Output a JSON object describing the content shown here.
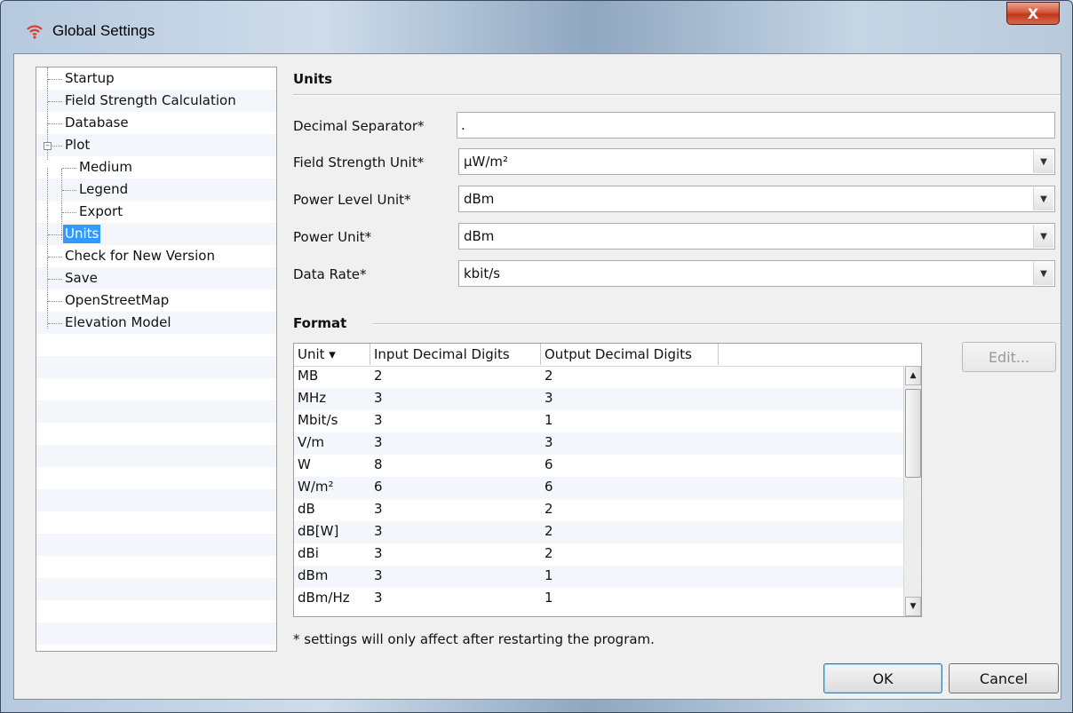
{
  "window": {
    "title": "Global Settings",
    "close_label": "X"
  },
  "tree": {
    "items": [
      {
        "label": "Startup",
        "level": 0
      },
      {
        "label": "Field Strength Calculation",
        "level": 0
      },
      {
        "label": "Database",
        "level": 0
      },
      {
        "label": "Plot",
        "level": 0,
        "expanded": true
      },
      {
        "label": "Medium",
        "level": 1
      },
      {
        "label": "Legend",
        "level": 1
      },
      {
        "label": "Export",
        "level": 1
      },
      {
        "label": "Units",
        "level": 0,
        "selected": true
      },
      {
        "label": "Check for New Version",
        "level": 0
      },
      {
        "label": "Save",
        "level": 0
      },
      {
        "label": "OpenStreetMap",
        "level": 0
      },
      {
        "label": "Elevation Model",
        "level": 0
      }
    ]
  },
  "units": {
    "heading": "Units",
    "decimal_separator": {
      "label": "Decimal Separator*",
      "value": "."
    },
    "field_strength_unit": {
      "label": "Field Strength Unit*",
      "value": "µW/m²"
    },
    "power_level_unit": {
      "label": "Power Level Unit*",
      "value": "dBm"
    },
    "power_unit": {
      "label": "Power Unit*",
      "value": "dBm"
    },
    "data_rate": {
      "label": "Data Rate*",
      "value": "kbit/s"
    }
  },
  "format": {
    "heading": "Format",
    "columns": [
      "Unit ▾",
      "Input Decimal Digits",
      "Output Decimal Digits"
    ],
    "rows": [
      [
        "MB",
        "2",
        "2"
      ],
      [
        "MHz",
        "3",
        "3"
      ],
      [
        "Mbit/s",
        "3",
        "1"
      ],
      [
        "V/m",
        "3",
        "3"
      ],
      [
        "W",
        "8",
        "6"
      ],
      [
        "W/m²",
        "6",
        "6"
      ],
      [
        "dB",
        "3",
        "2"
      ],
      [
        "dB[W]",
        "3",
        "2"
      ],
      [
        "dBi",
        "3",
        "2"
      ],
      [
        "dBm",
        "3",
        "1"
      ],
      [
        "dBm/Hz",
        "3",
        "1"
      ]
    ],
    "edit_label": "Edit..."
  },
  "note": "* settings will only affect after restarting the program.",
  "buttons": {
    "ok": "OK",
    "cancel": "Cancel"
  },
  "colors": {
    "selection": "#3399ff",
    "close_button": "#c7442a",
    "app_icon": "#e23a2a"
  },
  "icons": {
    "app": "wifi-signal-icon",
    "close": "close-icon",
    "combo_arrow": "chevron-down-icon"
  }
}
